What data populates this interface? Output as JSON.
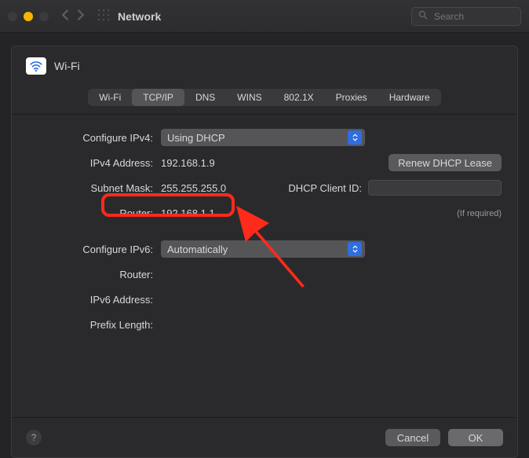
{
  "window": {
    "title": "Network",
    "search_placeholder": "Search"
  },
  "header": {
    "wifi_label": "Wi-Fi"
  },
  "tabs": [
    "Wi-Fi",
    "TCP/IP",
    "DNS",
    "WINS",
    "802.1X",
    "Proxies",
    "Hardware"
  ],
  "active_tab": "TCP/IP",
  "ipv4": {
    "configure_label": "Configure IPv4:",
    "configure_value": "Using DHCP",
    "address_label": "IPv4 Address:",
    "address_value": "192.168.1.9",
    "subnet_label": "Subnet Mask:",
    "subnet_value": "255.255.255.0",
    "router_label": "Router:",
    "router_value": "192.168.1.1",
    "renew_label": "Renew DHCP Lease",
    "client_id_label": "DHCP Client ID:",
    "client_id_value": "",
    "client_id_hint": "(If required)"
  },
  "ipv6": {
    "configure_label": "Configure IPv6:",
    "configure_value": "Automatically",
    "router_label": "Router:",
    "router_value": "",
    "address_label": "IPv6 Address:",
    "address_value": "",
    "prefix_label": "Prefix Length:",
    "prefix_value": ""
  },
  "footer": {
    "cancel": "Cancel",
    "ok": "OK"
  }
}
